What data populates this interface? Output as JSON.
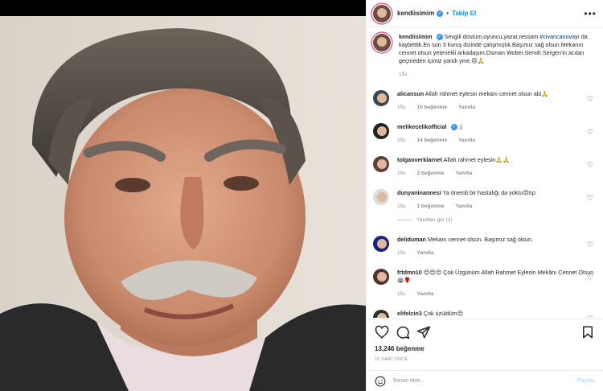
{
  "header": {
    "username": "kendiisimim",
    "follow_label": "Takip Et",
    "more_label": "•••"
  },
  "caption": {
    "username": "kendiisimim",
    "text_before_tag": "Sevgili dostum,oyuncu,yazar,ressam",
    "tag": "#civancanova",
    "text_after_tag": "yı da kaybettik.En son 3 kuruş dizinde çalışmıştık.Başımız sağ olsun.Mekanın cennet olsun yetenekli arkadaşım.Osman Wober.Semih Sergen'in acıları geçmeden içimiz yandı yine.😔🙏",
    "time": "15s"
  },
  "comments": [
    {
      "username": "alicansun",
      "text": "Allah rahmet eylesin mekanı cennet olsun abi🙏",
      "time": "15s",
      "likes": "10 beğenme",
      "reply": "Yanıtla",
      "verified": false
    },
    {
      "username": "melikecelikofficial",
      "text": ":(",
      "time": "15s",
      "likes": "14 beğenme",
      "reply": "Yanıtla",
      "verified": true
    },
    {
      "username": "tolgaoverklarnet",
      "text": "Allah rahmet eylesin🙏🙏",
      "time": "15s",
      "likes": "2 beğenme",
      "reply": "Yanıtla",
      "verified": false
    },
    {
      "username": "dunyaninannesi",
      "text": "Ya önemli bir hastalığı da yoktu😔tıp",
      "time": "15s",
      "likes": "1 beğenme",
      "reply": "Yanıtla",
      "verified": false,
      "thread": "Yanıtları gör (1)"
    },
    {
      "username": "deliduman",
      "text": "Mekanı cennet olsun. Başımız sağ olsun.",
      "time": "15s",
      "likes": "",
      "reply": "Yanıtla",
      "verified": false
    },
    {
      "username": "frtdmn10",
      "text": "😔😔😔 Çok Üzgünüm Allah Rahmet Eylesin Mekânı Cennet Olsun😭🌹",
      "time": "15s",
      "likes": "",
      "reply": "Yanıtla",
      "verified": false
    },
    {
      "username": "elifelcin3",
      "text": "Çok üzüldüm😔",
      "time": "",
      "likes": "",
      "reply": "",
      "verified": false
    }
  ],
  "actions": {
    "like_icon": "heart-icon",
    "comment_icon": "comment-icon",
    "share_icon": "share-icon",
    "save_icon": "bookmark-icon"
  },
  "likes_count": "13,246 beğenme",
  "posted_time": "15 SAAT ÖNCE",
  "add_comment": {
    "placeholder": "Yorum ekle...",
    "post_label": "Paylaş"
  },
  "colors": {
    "accent": "#0095f6",
    "verified": "#3897f0",
    "muted": "#8e8e8e",
    "post_disabled": "#b2dffc"
  }
}
